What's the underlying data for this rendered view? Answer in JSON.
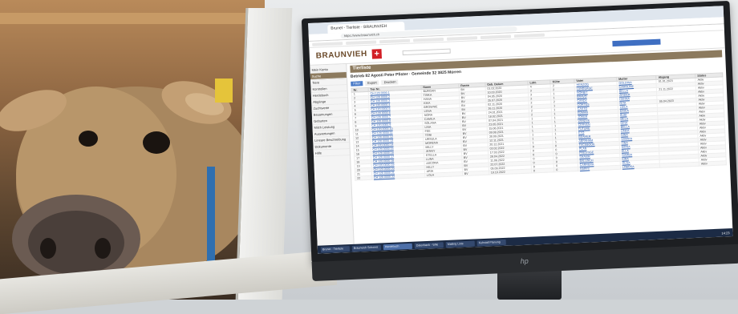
{
  "browser": {
    "tab_title": "Brunet - Tierliste - BRAUNVIEH",
    "url": "https://www.braunvieh.ch"
  },
  "app": {
    "brand": "BRAUNVIEH",
    "brand_cross": "+",
    "page_heading": "Tierliste",
    "subtitle": "Betrieb 82 Agosti Peter Pfister · Gemeinde 32 3825 Mürren"
  },
  "sidebar": {
    "items": [
      {
        "label": "Mein Konto",
        "active": false
      },
      {
        "label": "Suche",
        "active": true
      },
      {
        "label": "Tiere",
        "active": false
      },
      {
        "label": "Kontrollen",
        "active": false
      },
      {
        "label": "Herdebuch",
        "active": false
      },
      {
        "label": "Abgänge",
        "active": false
      },
      {
        "label": "Zuchtwerte",
        "active": false
      },
      {
        "label": "Besamungen",
        "active": false
      },
      {
        "label": "Geburten",
        "active": false
      },
      {
        "label": "Milch Leistung",
        "active": false
      },
      {
        "label": "Auswertungen",
        "active": false
      },
      {
        "label": "Lineare Beschreibung",
        "active": false
      },
      {
        "label": "Dokumente",
        "active": false
      },
      {
        "label": "Hilfe",
        "active": false
      }
    ]
  },
  "toolbar": {
    "filter_label": "Filter",
    "export_label": "Export",
    "print_label": "Drucken"
  },
  "table": {
    "columns": [
      "Nr.",
      "Tier Nr.",
      "Name",
      "Rasse",
      "Geb. Datum",
      "Lakt.",
      "Kühe",
      "Vater",
      "Mutter",
      "Abgang",
      "Status"
    ],
    "rows": [
      [
        "1",
        "CH 120.0000.1",
        "BURGAN",
        "BV",
        "01.02.2020",
        "4",
        "2",
        "HERZOG",
        "GOLDINA",
        "01.01.2023",
        "Aktiv"
      ],
      [
        "2",
        "CH 120.0000.2",
        "TINKA",
        "BV",
        "10.03.2020",
        "3",
        "2",
        "LANGUAGE",
        "CAROLINE",
        "",
        "Aktiv"
      ],
      [
        "3",
        "CH 120.0000.3",
        "HANA",
        "BV",
        "04.05.2020",
        "3",
        "1",
        "NORBIT",
        "BELLA",
        "21.11.2022",
        "Aktiv"
      ],
      [
        "4",
        "CH 120.0000.4",
        "KIKA",
        "BV",
        "25.07.2020",
        "2",
        "1",
        "BRAVO",
        "ZINDER",
        "",
        "Aktiv"
      ],
      [
        "5",
        "CH 120.0000.5",
        "BROWNIE",
        "BV",
        "02.11.2020",
        "2",
        "2",
        "CANDY",
        "HANNA",
        "",
        "Aktiv"
      ],
      [
        "6",
        "CH 120.0000.6",
        "LENA",
        "BV",
        "26.11.2020",
        "2",
        "1",
        "CORTES",
        "RITA",
        "05.04.2023",
        "Aktiv"
      ],
      [
        "7",
        "CH 120.0000.7",
        "NORA",
        "BV",
        "24.01.2021",
        "2",
        "1",
        "CASTO",
        "LEILA",
        "",
        "Aktiv"
      ],
      [
        "8",
        "CH 120.0000.8",
        "CAMILA",
        "BV",
        "18.02.2021",
        "2",
        "1",
        "EDMAR",
        "ERICA",
        "",
        "Aktiv"
      ],
      [
        "9",
        "CH 120.0000.9",
        "SOLANA",
        "BV",
        "07.04.2021",
        "1",
        "1",
        "JOKER",
        "BUBI",
        "",
        "Aktiv"
      ],
      [
        "10",
        "CH 120.0000.10",
        "LINA",
        "BV",
        "23.05.2021",
        "1",
        "1",
        "VANDYK",
        "MELA",
        "",
        "Aktiv"
      ],
      [
        "11",
        "CH 120.0000.11",
        "FEE",
        "BV",
        "15.06.2021",
        "1",
        "1",
        "CERVEN",
        "GINA",
        "",
        "Aktiv"
      ],
      [
        "12",
        "CH 120.0000.12",
        "TONI",
        "BV",
        "09.08.2021",
        "1",
        "1",
        "FUTURE",
        "BELLA",
        "",
        "Aktiv"
      ],
      [
        "13",
        "CH 120.0000.13",
        "URSULA",
        "BV",
        "30.09.2021",
        "1",
        "1",
        "ETO",
        "LINDA",
        "",
        "Aktiv"
      ],
      [
        "14",
        "CH 120.0000.14",
        "MORENA",
        "BV",
        "12.11.2021",
        "1",
        "1",
        "BEAMER",
        "NINA",
        "",
        "Aktiv"
      ],
      [
        "15",
        "CH 120.0000.15",
        "MILLY",
        "BV",
        "20.12.2021",
        "1",
        "1",
        "ABRAHAM",
        "SAMIRA",
        "",
        "Aktiv"
      ],
      [
        "16",
        "CH 120.0000.16",
        "JENNY",
        "BV",
        "03.02.2022",
        "0",
        "0",
        "FACEBOOK",
        "TINA",
        "",
        "Aktiv"
      ],
      [
        "17",
        "CH 120.0000.17",
        "STELLA",
        "BV",
        "17.03.2022",
        "0",
        "0",
        "PLAN",
        "MONA",
        "",
        "Aktiv"
      ],
      [
        "18",
        "CH 120.0000.18",
        "LUNA",
        "BV",
        "28.04.2022",
        "0",
        "0",
        "PRESTIGE",
        "ELLA",
        "",
        "Aktiv"
      ],
      [
        "19",
        "CH 120.0000.19",
        "ASCONA",
        "BV",
        "11.06.2022",
        "0",
        "0",
        "SHAKIR",
        "GAMBA",
        "",
        "Aktiv"
      ],
      [
        "20",
        "CH 120.0000.20",
        "HILLY",
        "BV",
        "22.07.2022",
        "0",
        "0",
        "BALUSCH",
        "KIRA",
        "",
        "Aktiv"
      ],
      [
        "21",
        "CH 120.0000.21",
        "ARIA",
        "BV",
        "05.09.2022",
        "0",
        "0",
        "CARRERA",
        "OLGA",
        "",
        "Aktiv"
      ],
      [
        "22",
        "CH 120.0000.22",
        "LOLA",
        "BV",
        "19.10.2022",
        "0",
        "0",
        "HAPPY",
        "LOBOSA",
        "",
        "Aktiv"
      ]
    ]
  },
  "taskbar": {
    "items": [
      {
        "label": "Brunet - Tierliste",
        "active": false
      },
      {
        "label": "Braunvieh Schweiz",
        "active": false
      },
      {
        "label": "Herdebuch",
        "active": true
      },
      {
        "label": "Datenbank - Wiki",
        "active": false
      },
      {
        "label": "Mailing Liste",
        "active": false
      },
      {
        "label": "Kuhstall Planung",
        "active": false
      }
    ],
    "clock": "14:23"
  },
  "colors": {
    "brand": "#6b4a2a",
    "accent": "#d21f26",
    "banner": "#8c7a5e",
    "link": "#2a5db0"
  }
}
